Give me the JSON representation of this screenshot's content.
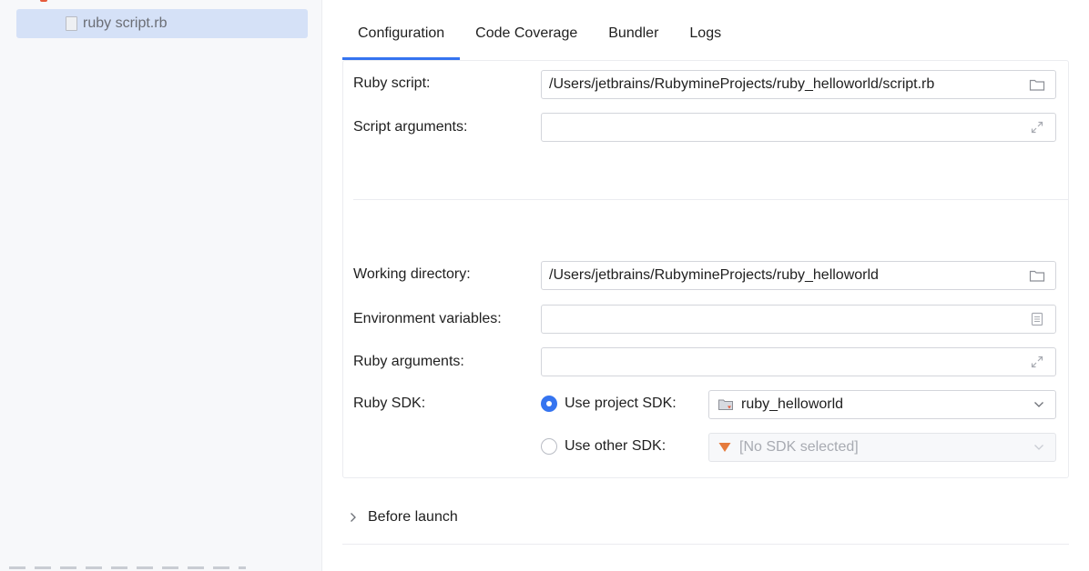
{
  "sidebar": {
    "selected_item": {
      "label": "ruby script.rb",
      "icon": "file-icon"
    }
  },
  "tabs": [
    {
      "label": "Configuration",
      "active": true
    },
    {
      "label": "Code Coverage",
      "active": false
    },
    {
      "label": "Bundler",
      "active": false
    },
    {
      "label": "Logs",
      "active": false
    }
  ],
  "form": {
    "ruby_script": {
      "label": "Ruby script:",
      "value": "/Users/jetbrains/RubymineProjects/ruby_helloworld/script.rb",
      "icon": "folder-icon"
    },
    "script_arguments": {
      "label": "Script arguments:",
      "value": "",
      "icon": "expand-icon"
    },
    "working_directory": {
      "label": "Working directory:",
      "value": "/Users/jetbrains/RubymineProjects/ruby_helloworld",
      "icon": "folder-icon"
    },
    "environment_variables": {
      "label": "Environment variables:",
      "value": "",
      "icon": "list-icon"
    },
    "ruby_arguments": {
      "label": "Ruby arguments:",
      "value": "",
      "icon": "expand-icon"
    },
    "ruby_sdk": {
      "label": "Ruby SDK:",
      "use_project_sdk": {
        "label": "Use project SDK:",
        "selected": true,
        "value": "ruby_helloworld",
        "icon": "project-folder-icon"
      },
      "use_other_sdk": {
        "label": "Use other SDK:",
        "selected": false,
        "value": "[No SDK selected]",
        "icon": "ruby-gem-icon"
      }
    }
  },
  "before_launch": {
    "label": "Before launch"
  },
  "colors": {
    "accent": "#3574f0",
    "selection": "#d5e1f7",
    "sidebar_bg": "#f7f8fa",
    "ruby_red": "#e55b3c"
  }
}
